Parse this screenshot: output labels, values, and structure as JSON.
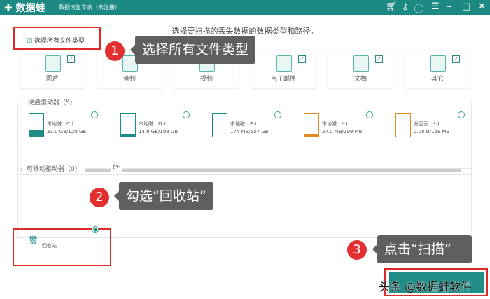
{
  "app": {
    "title": "数据蛙",
    "subtitle": "数据恢复专家（未注册）",
    "icons": [
      "cart-icon",
      "key-icon",
      "help-icon",
      "menu-icon",
      "minimize-icon",
      "maximize-icon",
      "close-icon"
    ]
  },
  "heading": "选择要扫描的丢失数据的数据类型和路径。",
  "select_all": {
    "label": "选择所有文件类型",
    "checked": true
  },
  "categories": [
    {
      "label": "图片",
      "checked": true
    },
    {
      "label": "音频",
      "checked": true
    },
    {
      "label": "视频",
      "checked": true
    },
    {
      "label": "电子邮件",
      "checked": true
    },
    {
      "label": "文档",
      "checked": true
    },
    {
      "label": "其它",
      "checked": true
    }
  ],
  "hard_drives": {
    "title": "硬盘驱动器（5）",
    "items": [
      {
        "name": "本地磁…C:)",
        "size": "33.0 GB/120 GB",
        "fill": 0.28,
        "color": "#1f8c86"
      },
      {
        "name": "本地磁…D:)",
        "size": "14.9 GB/199 GB",
        "fill": 0.08,
        "color": "#1f8c86"
      },
      {
        "name": "本地磁…E:)",
        "size": "174 MB/157 GB",
        "fill": 0.0,
        "color": "#1f8c86"
      },
      {
        "name": "本地磁…*:)",
        "size": "27.0 MB/299 MB",
        "fill": 0.09,
        "color": "#e8891f"
      },
      {
        "name": "分区丢…*:)",
        "size": "0.00  B/128 MB",
        "fill": 0.0,
        "color": "#e8891f"
      }
    ]
  },
  "removable": {
    "title": "可移动驱动器（0）"
  },
  "recycle_bin": {
    "label": "回收站",
    "selected": true
  },
  "callouts": [
    {
      "num": "1",
      "text": "选择所有文件类型"
    },
    {
      "num": "2",
      "text": "勾选“回收站”"
    },
    {
      "num": "3",
      "text": "点击“扫描”"
    }
  ],
  "scan_button": {
    "watermark": "头条 @数据蛙软件"
  }
}
